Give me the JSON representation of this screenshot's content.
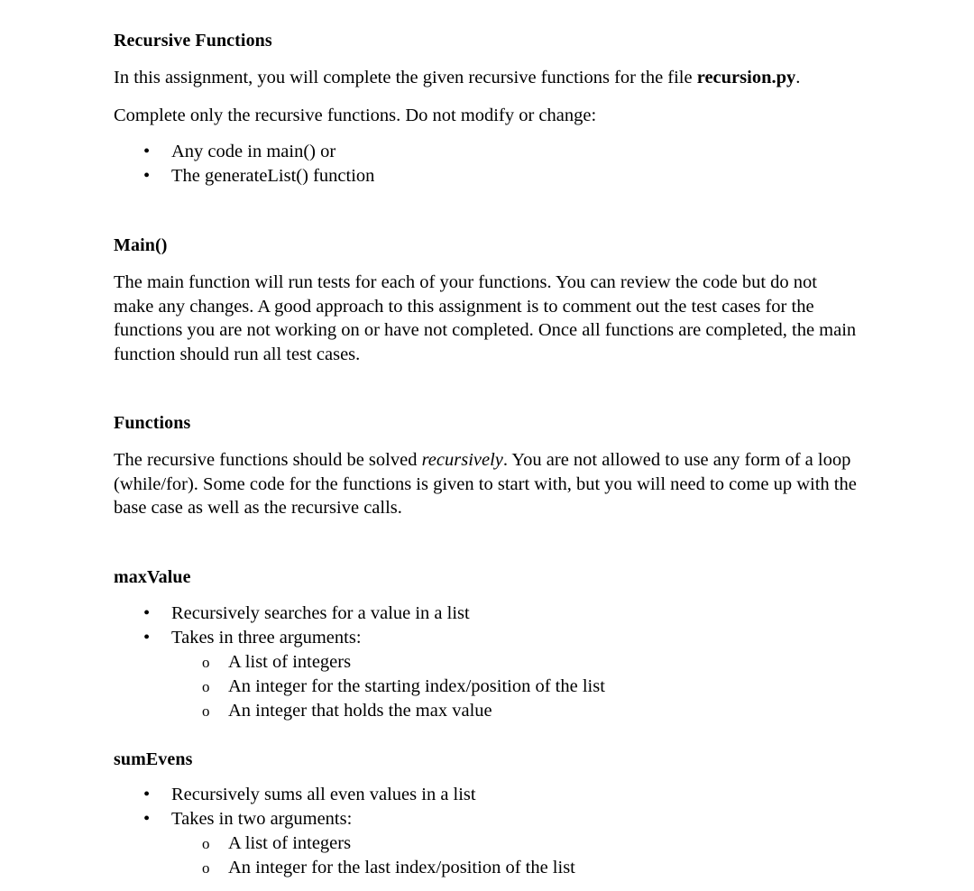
{
  "document": {
    "title": "Recursive Functions",
    "intro": {
      "before_bold": "In this assignment, you will complete the given recursive functions for the file ",
      "bold": "recursion.py",
      "after_bold": "."
    },
    "instruction": "Complete only the recursive functions. Do not modify or change:",
    "do_not_modify_items": [
      "Any code in main() or",
      "The generateList() function"
    ],
    "sections": [
      {
        "heading": "Main()",
        "paragraph": "The main function will run tests for each of your functions. You can review the code but do not make any changes. A good approach to this assignment is to comment out the test cases for the functions you are not working on or have not completed. Once all functions are completed, the main function should run all test cases."
      },
      {
        "heading": "Functions",
        "paragraph_part1": "The recursive functions should be solved ",
        "paragraph_italic": "recursively",
        "paragraph_part2": ". You are not allowed to use any form of a loop (while/for). Some code for the functions is given to start with, but you will need to come up with the base case as well as the recursive calls."
      }
    ],
    "functions": [
      {
        "name": "maxValue",
        "bullets": [
          {
            "text": "Recursively searches for a value in a list",
            "sub": []
          },
          {
            "text": "Takes in three arguments:",
            "sub": [
              "A list of integers",
              "An integer for the starting index/position of the list",
              "An integer that holds the max value"
            ]
          }
        ]
      },
      {
        "name": "sumEvens",
        "bullets": [
          {
            "text": "Recursively sums all even values in a list",
            "sub": []
          },
          {
            "text": "Takes in two arguments:",
            "sub": [
              "A list of integers",
              "An integer for the last index/position of the list"
            ]
          }
        ]
      }
    ],
    "markers": {
      "bullet": "•",
      "sub_bullet": "o"
    }
  }
}
